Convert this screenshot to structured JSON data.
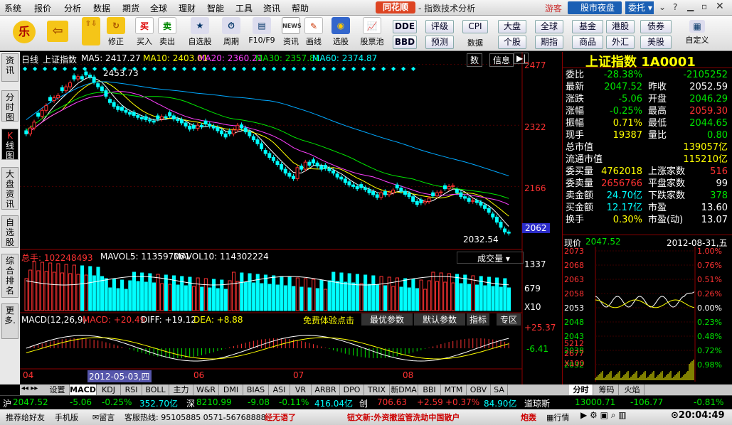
{
  "menu": [
    "系统",
    "报价",
    "分析",
    "数据",
    "期货",
    "全球",
    "理财",
    "智能",
    "工具",
    "资讯",
    "帮助"
  ],
  "app": {
    "logo": "同花顺",
    "title": "- 指数技术分析",
    "guest": "游客",
    "night_label": "股市夜盘",
    "weituo_label": "委托"
  },
  "toolbar": {
    "buttons": [
      {
        "icon": "乐",
        "label": ""
      },
      {
        "icon": "⇦",
        "label": ""
      },
      {
        "icon": "⇧⇩",
        "label": ""
      },
      {
        "icon": "↻",
        "label": "修正"
      },
      {
        "icon": "买",
        "label": "买入"
      },
      {
        "icon": "卖",
        "label": "卖出"
      },
      {
        "icon": "★",
        "label": "自选股"
      },
      {
        "icon": "⏱",
        "label": "周期"
      },
      {
        "icon": "▤",
        "label": "F10/F9"
      },
      {
        "icon": "NEWS",
        "label": "资讯"
      },
      {
        "icon": "✎",
        "label": "画线"
      },
      {
        "icon": "◉",
        "label": "选股"
      },
      {
        "icon": "📈",
        "label": "股票池"
      }
    ],
    "small": [
      [
        "DDE",
        "BBD"
      ],
      [
        "评级",
        "预测"
      ],
      [
        "CPI",
        "数据"
      ],
      [
        "大盘",
        "个股"
      ],
      [
        "全球",
        "期指"
      ],
      [
        "基金",
        "商品"
      ],
      [
        "港股",
        "外汇"
      ],
      [
        "债券",
        "美股"
      ],
      [
        "自定义"
      ]
    ]
  },
  "left_tabs": [
    {
      "text": "资讯",
      "active": false
    },
    {
      "text": "分时图",
      "active": false
    },
    {
      "k": "K",
      "text": "线图",
      "active": true
    },
    {
      "text": "大盘资讯",
      "active": false
    },
    {
      "text": "自选股",
      "active": false
    },
    {
      "text": "综合排名",
      "active": false
    },
    {
      "text": "更多.",
      "active": false
    }
  ],
  "chart_header": {
    "period": "日线",
    "name": "上证指数",
    "ma5": "MA5: 2417.27",
    "ma10": "MA10: 2403.01",
    "ma20": "MA20: 2360.21",
    "ma30": "MA30: 2357.81",
    "ma60": "MA60: 2374.87",
    "btn1": "数",
    "btn2": "信息"
  },
  "price_axis": [
    "2477",
    "2322",
    "2166",
    "2062"
  ],
  "high_label": "2453.73",
  "low_label": "2032.54",
  "colors": {
    "up": "#ff3232",
    "down": "#00ffff",
    "ma5": "#ffffff",
    "ma10": "#ffff00",
    "ma20": "#ff40ff",
    "ma30": "#00e600",
    "ma60": "#00a8ff"
  },
  "chart_data": [
    {
      "type": "candlestick",
      "title": "上证指数 日线",
      "x_labels": [
        "04",
        "06",
        "07",
        "08"
      ],
      "y_ticks": [
        2477,
        2322,
        2166,
        2062
      ],
      "ylim": [
        2020,
        2480
      ],
      "series": [
        {
          "name": "MA5",
          "value": 2417.27
        },
        {
          "name": "MA10",
          "value": 2403.01
        },
        {
          "name": "MA20",
          "value": 2360.21
        },
        {
          "name": "MA30",
          "value": 2357.81
        },
        {
          "name": "MA60",
          "value": 2374.87
        }
      ],
      "closes": [
        2300,
        2315,
        2330,
        2345,
        2360,
        2372,
        2385,
        2392,
        2398,
        2410,
        2420,
        2430,
        2440,
        2446,
        2440,
        2450,
        2445,
        2432,
        2420,
        2410,
        2396,
        2380,
        2370,
        2362,
        2360,
        2355,
        2350,
        2347,
        2342,
        2338,
        2336,
        2333,
        2330,
        2338,
        2344,
        2341,
        2346,
        2338,
        2334,
        2328,
        2320,
        2312,
        2314,
        2322,
        2318,
        2325,
        2320,
        2315,
        2308,
        2300,
        2292,
        2300,
        2310,
        2322,
        2315,
        2305,
        2295,
        2285,
        2275,
        2262,
        2250,
        2240,
        2232,
        2222,
        2210,
        2200,
        2192,
        2186,
        2214,
        2210,
        2228,
        2220,
        2226,
        2218,
        2210,
        2212,
        2206,
        2200,
        2190,
        2185,
        2176,
        2170,
        2166,
        2160,
        2163,
        2158,
        2150,
        2145,
        2138,
        2150,
        2145,
        2150,
        2157,
        2162,
        2154,
        2146,
        2140,
        2128,
        2120,
        2124,
        2128,
        2136,
        2142,
        2150,
        2152,
        2160,
        2166,
        2168,
        2150,
        2140,
        2136,
        2128,
        2130,
        2125,
        2118,
        2110,
        2100,
        2088,
        2075,
        2062,
        2050,
        2047
      ]
    },
    {
      "type": "bar",
      "title": "总手",
      "values_label": {
        "total": "总手: 102248493",
        "mavol5": "MAVOL5: 113597061",
        "mavol10": "MAVOL10: 114302224"
      },
      "y_ticks": [
        "1337",
        "679",
        "X10"
      ],
      "selector": "成交量"
    },
    {
      "type": "bar",
      "title": "MACD(12,26,9)",
      "values_label": {
        "macd": "MACD: +20.49",
        "diff": "DIFF: +19.12",
        "dea": "DEA: +8.88"
      },
      "y_ticks": [
        "+25.37",
        "-6.41"
      ]
    }
  ],
  "volume_panel": {
    "total": "总手: 102248493",
    "mavol5": "MAVOL5: 113597061",
    "mavol10": "MAVOL10: 114302224",
    "axis": [
      "1337",
      "679",
      "X10"
    ],
    "selector": "成交量"
  },
  "macd_panel": {
    "title": "MACD(12,26,9)",
    "macd": "MACD: +20.49",
    "diff": "DIFF: +19.12",
    "dea": "DEA: +8.88",
    "promo": "免费体验点击",
    "btn1": "最优参数",
    "btn2": "默认参数",
    "btn3": "指标",
    "btn4": "专区",
    "axis": [
      "+25.37",
      "-6.41"
    ]
  },
  "date_axis": {
    "labels": [
      "04",
      "06",
      "07",
      "08"
    ],
    "cursor": "2012-05-03,四"
  },
  "quote": {
    "title": "上证指数 1A0001",
    "rows": [
      {
        "l": "委比",
        "v": "-28.38%",
        "l2": "",
        "v2": "-2105252",
        "c": "grn",
        "c2": "grn"
      },
      {
        "l": "最新",
        "v": "2047.52",
        "l2": "昨收",
        "v2": "2052.59",
        "c": "grn",
        "c2": "wht"
      },
      {
        "l": "涨跌",
        "v": "-5.06",
        "l2": "开盘",
        "v2": "2046.29",
        "c": "grn",
        "c2": "grn"
      },
      {
        "l": "涨幅",
        "v": "-0.25%",
        "l2": "最高",
        "v2": "2059.30",
        "c": "grn",
        "c2": "red"
      },
      {
        "l": "振幅",
        "v": "0.71%",
        "l2": "最低",
        "v2": "2044.65",
        "c": "yel",
        "c2": "grn"
      },
      {
        "l": "现手",
        "v": "19387",
        "l2": "量比",
        "v2": "0.80",
        "c": "yel",
        "c2": "grn"
      },
      {
        "l": "总市值",
        "v": "139057亿",
        "l2": "",
        "v2": "",
        "c": "yel",
        "c2": "yel"
      },
      {
        "l": "流通市值",
        "v": "115210亿",
        "l2": "",
        "v2": "",
        "c": "yel",
        "c2": "yel"
      },
      {
        "l": "委买量",
        "v": "4762018",
        "l2": "上涨家数",
        "v2": "516",
        "c": "yel",
        "c2": "red"
      },
      {
        "l": "委卖量",
        "v": "2656766",
        "l2": "平盘家数",
        "v2": "99",
        "c": "red",
        "c2": "wht"
      },
      {
        "l": "卖金额",
        "v": "24.70亿",
        "l2": "下跌家数",
        "v2": "378",
        "c": "cyn",
        "c2": "grn"
      },
      {
        "l": "买金额",
        "v": "12.17亿",
        "l2": "市盈",
        "v2": "13.60",
        "c": "cyn",
        "c2": "wht"
      },
      {
        "l": "换手",
        "v": "0.30%",
        "l2": "市盈(动)",
        "v2": "13.07",
        "c": "yel",
        "c2": "wht"
      }
    ],
    "minute_header": "现价",
    "minute_price": "2047.52",
    "minute_date": "2012-08-31,五",
    "mini_left": [
      "2073",
      "2068",
      "2063",
      "2058",
      "2053",
      "2048",
      "2043",
      "2038",
      "2032",
      "5212",
      "2677",
      "X100"
    ],
    "mini_right": [
      "1.00%",
      "0.76%",
      "0.51%",
      "0.26%",
      "0.00%",
      "0.23%",
      "0.48%",
      "0.72%",
      "0.98%"
    ],
    "tabs": [
      "分时",
      "筹码",
      "火焰"
    ]
  },
  "bottom_tabs": [
    "设置",
    "MACD",
    "KDJ",
    "RSI",
    "BOLL",
    "主力",
    "W&R",
    "DMI",
    "BIAS",
    "ASI",
    "VR",
    "ARBR",
    "DPO",
    "TRIX",
    "新DMA",
    "BBI",
    "MTM",
    "OBV",
    "SA"
  ],
  "ticker": {
    "sh_label": "沪",
    "sh_val": "2047.52",
    "sh_chg": "-5.06",
    "sh_pct": "-0.25%",
    "sh_amt": "352.70亿",
    "sz_label": "深",
    "sz_val": "8210.99",
    "sz_chg": "-9.08",
    "sz_pct": "-0.11%",
    "sz_amt": "416.04亿",
    "cy_label": "创",
    "cy_val": "706.63",
    "cy_chg": "+2.59",
    "cy_pct": "+0.37%",
    "cy_amt": "84.90亿",
    "dj_label": "道琼斯",
    "dj_val": "13000.71",
    "dj_chg": "-106.77",
    "dj_pct": "-0.81%"
  },
  "status": {
    "recommend": "推荐给好友",
    "phone": "手机版",
    "msg": "留言",
    "hotline": "客服热线: 95105885 0571-56768888",
    "news1": "经无语了",
    "news2": "钮文新:外资撤监管洗劫中国散户",
    "news3": "炮轰",
    "quotes": "行情",
    "time": "20:04:49"
  }
}
